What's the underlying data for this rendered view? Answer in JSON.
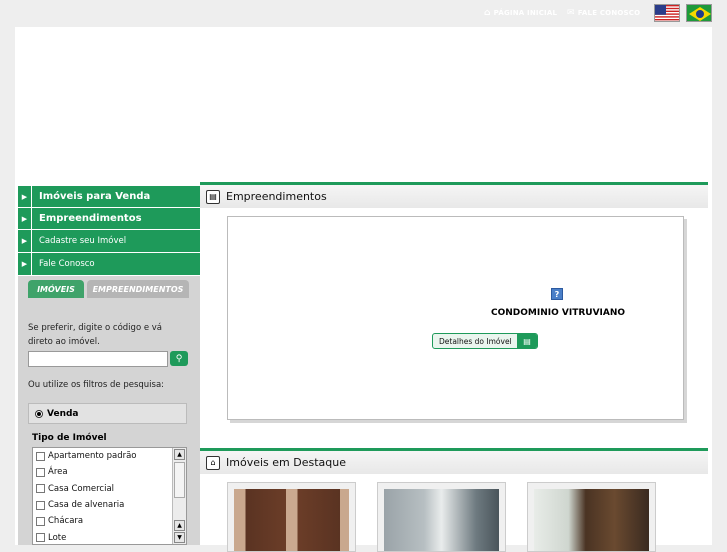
{
  "top": {
    "home_label": "PÁGINA INICIAL",
    "contact_label": "FALE CONOSCO",
    "flag_en": "english-flag",
    "flag_pt": "portuguese-flag"
  },
  "menu": {
    "items": [
      {
        "label": "Imóveis para Venda"
      },
      {
        "label": "Empreendimentos"
      },
      {
        "label": "Cadastre seu Imóvel"
      },
      {
        "label": "Fale Conosco"
      }
    ]
  },
  "search": {
    "tabs": [
      "IMÓVEIS",
      "EMPREENDIMENTOS"
    ],
    "hint_code": "Se preferir, digite o código e vá direto ao imóvel.",
    "code_value": "",
    "hint_filters": "Ou utilize os filtros de pesquisa:",
    "mode_label": "Venda",
    "type_title": "Tipo de Imóvel",
    "types": [
      "Apartamento padrão",
      "Área",
      "Casa Comercial",
      "Casa de alvenaria",
      "Chácara",
      "Lote"
    ]
  },
  "sections": {
    "empreendimentos_title": "Empreendimentos",
    "destaque_title": "Imóveis em Destaque"
  },
  "empreendimento": {
    "name": "CONDOMINIO VITRUVIANO",
    "details_label": "Detalhes do Imóvel",
    "image_icon": "?"
  },
  "colors": {
    "accent": "#1e9a5a",
    "background": "#eeeeee"
  }
}
